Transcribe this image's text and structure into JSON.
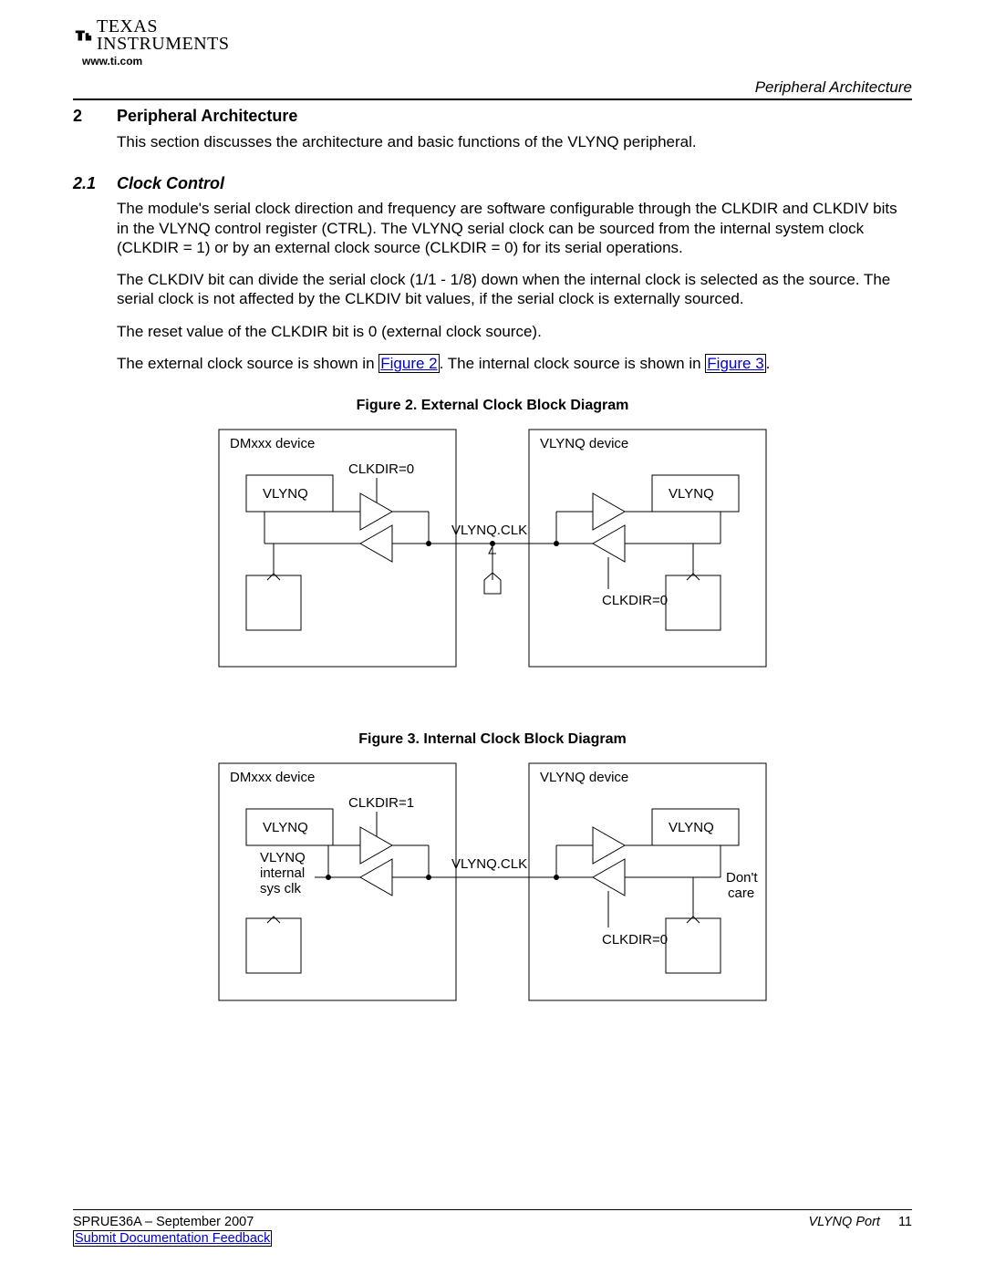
{
  "logo": {
    "brand_top": "TEXAS",
    "brand_bottom": "INSTRUMENTS",
    "url": "www.ti.com"
  },
  "header": {
    "right": "Peripheral Architecture"
  },
  "section": {
    "num": "2",
    "title": "Peripheral Architecture",
    "intro": "This section discusses the architecture and basic functions of the VLYNQ peripheral."
  },
  "subsection": {
    "num": "2.1",
    "title": "Clock Control",
    "p1": "The module's serial clock direction and frequency are software configurable through the CLKDIR and CLKDIV bits in the VLYNQ control register (CTRL). The VLYNQ serial clock can be sourced from the internal system clock (CLKDIR = 1) or by an external clock source (CLKDIR = 0) for its serial operations.",
    "p2": "The CLKDIV bit can divide the serial clock (1/1 - 1/8) down when the internal clock is selected as the source. The serial clock is not affected by the CLKDIV bit values, if the serial clock is externally sourced.",
    "p3": "The reset value of the CLKDIR bit is 0 (external clock source).",
    "p4a": "The external clock source is shown in ",
    "p4_link1": "Figure 2",
    "p4b": ". The internal clock source is shown in ",
    "p4_link2": "Figure 3",
    "p4c": "."
  },
  "fig2": {
    "caption": "Figure 2. External Clock Block Diagram",
    "left_device": "DMxxx device",
    "right_device": "VLYNQ device",
    "vlynq_label": "VLYNQ",
    "clkdir_left": "CLKDIR=0",
    "vlynq_clk": "VLYNQ.CLK",
    "clkdir_right": "CLKDIR=0"
  },
  "fig3": {
    "caption": "Figure 3. Internal Clock Block Diagram",
    "left_device": "DMxxx device",
    "right_device": "VLYNQ device",
    "vlynq_label": "VLYNQ",
    "vlynq_internal": "VLYNQ",
    "internal_1": "internal",
    "internal_2": "sys clk",
    "clkdir_left": "CLKDIR=1",
    "vlynq_clk": "VLYNQ.CLK",
    "clkdir_right": "CLKDIR=0",
    "dontcare_1": "Don't",
    "dontcare_2": "care"
  },
  "footer": {
    "doc_id": "SPRUE36A – September 2007",
    "feedback": "Submit Documentation Feedback",
    "right_label": "VLYNQ Port",
    "page": "11"
  }
}
